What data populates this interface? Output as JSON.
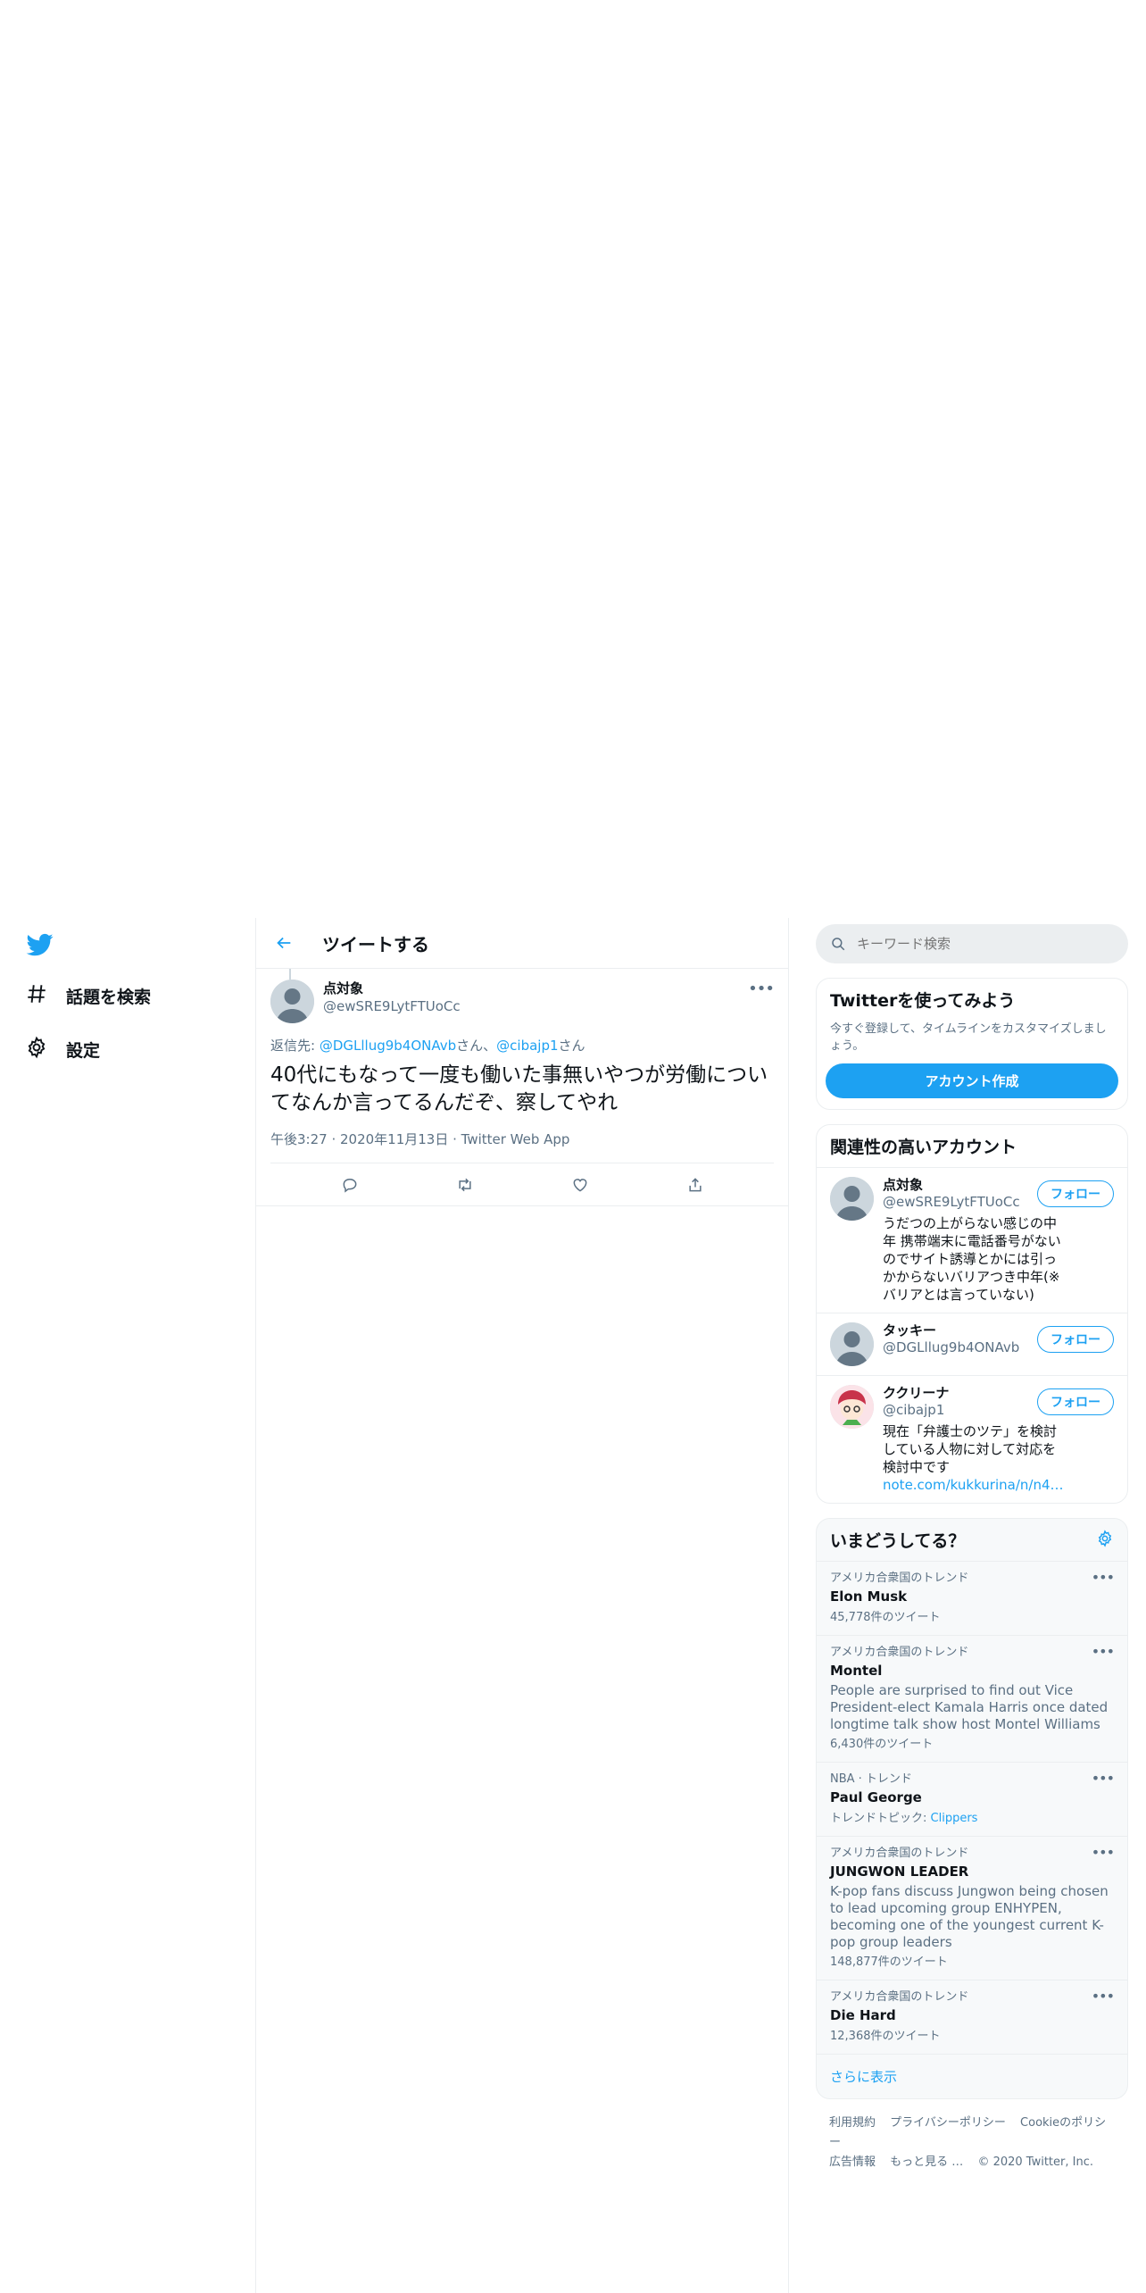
{
  "nav": {
    "items": [
      {
        "label": "話題を検索",
        "icon": "hashtag-icon"
      },
      {
        "label": "設定",
        "icon": "gear-icon"
      }
    ]
  },
  "header": {
    "title": "ツイートする"
  },
  "tweet": {
    "display_name": "点対象",
    "handle": "@ewSRE9LytFTUoCc",
    "reply_prefix": "返信先: ",
    "reply_to": [
      "@DGLllug9b4ONAvb",
      "@cibajp1"
    ],
    "reply_suffix": "さん",
    "reply_sep": "さん、",
    "text": "40代にもなって一度も働いた事無いやつが労働についてなんか言ってるんだぞ、察してやれ",
    "meta": "午後3:27 · 2020年11月13日 · Twitter Web App"
  },
  "search": {
    "placeholder": "キーワード検索"
  },
  "signup": {
    "title": "Twitterを使ってみよう",
    "desc": "今すぐ登録して、タイムラインをカスタマイズしましょう。",
    "button": "アカウント作成"
  },
  "related": {
    "title": "関連性の高いアカウント",
    "follow_label": "フォロー",
    "accounts": [
      {
        "name": "点対象",
        "handle": "@ewSRE9LytFTUoCc",
        "bio": "うだつの上がらない感じの中年 携帯端末に電話番号がないのでサイト誘導とかには引っかからないバリアつき中年(※バリアとは言っていない)"
      },
      {
        "name": "タッキー",
        "handle": "@DGLllug9b4ONAvb",
        "bio": ""
      },
      {
        "name": "ククリーナ",
        "handle": "@cibajp1",
        "bio": "現在「弁護士のツテ」を検討している人物に対して対応を検討中です",
        "link": "note.com/kukkurina/n/n4…"
      }
    ]
  },
  "trends": {
    "title": "いまどうしてる？",
    "items": [
      {
        "meta": "アメリカ合衆国のトレンド",
        "name": "Elon Musk",
        "desc": "",
        "count": "45,778件のツイート"
      },
      {
        "meta": "アメリカ合衆国のトレンド",
        "name": "Montel",
        "desc": "People are surprised to find out Vice President-elect Kamala Harris once dated longtime talk show host Montel Williams",
        "count": "6,430件のツイート"
      },
      {
        "meta": "NBA · トレンド",
        "name": "Paul George",
        "desc": "",
        "count": "",
        "topic_prefix": "トレンドトピック: ",
        "topic": "Clippers"
      },
      {
        "meta": "アメリカ合衆国のトレンド",
        "name": "JUNGWON LEADER",
        "desc": "K-pop fans discuss Jungwon being chosen to lead upcoming group ENHYPEN, becoming one of the youngest current K-pop group leaders",
        "count": "148,877件のツイート"
      },
      {
        "meta": "アメリカ合衆国のトレンド",
        "name": "Die Hard",
        "desc": "",
        "count": "12,368件のツイート"
      }
    ],
    "show_more": "さらに表示"
  },
  "footer": {
    "links": [
      "利用規約",
      "プライバシーポリシー",
      "Cookieのポリシー",
      "広告情報",
      "もっと見る …"
    ],
    "copyright": "© 2020 Twitter, Inc."
  },
  "colors": {
    "accent": "#1da1f2",
    "text": "#0f1419",
    "secondary": "#5b7083",
    "border": "#ebeef0"
  }
}
